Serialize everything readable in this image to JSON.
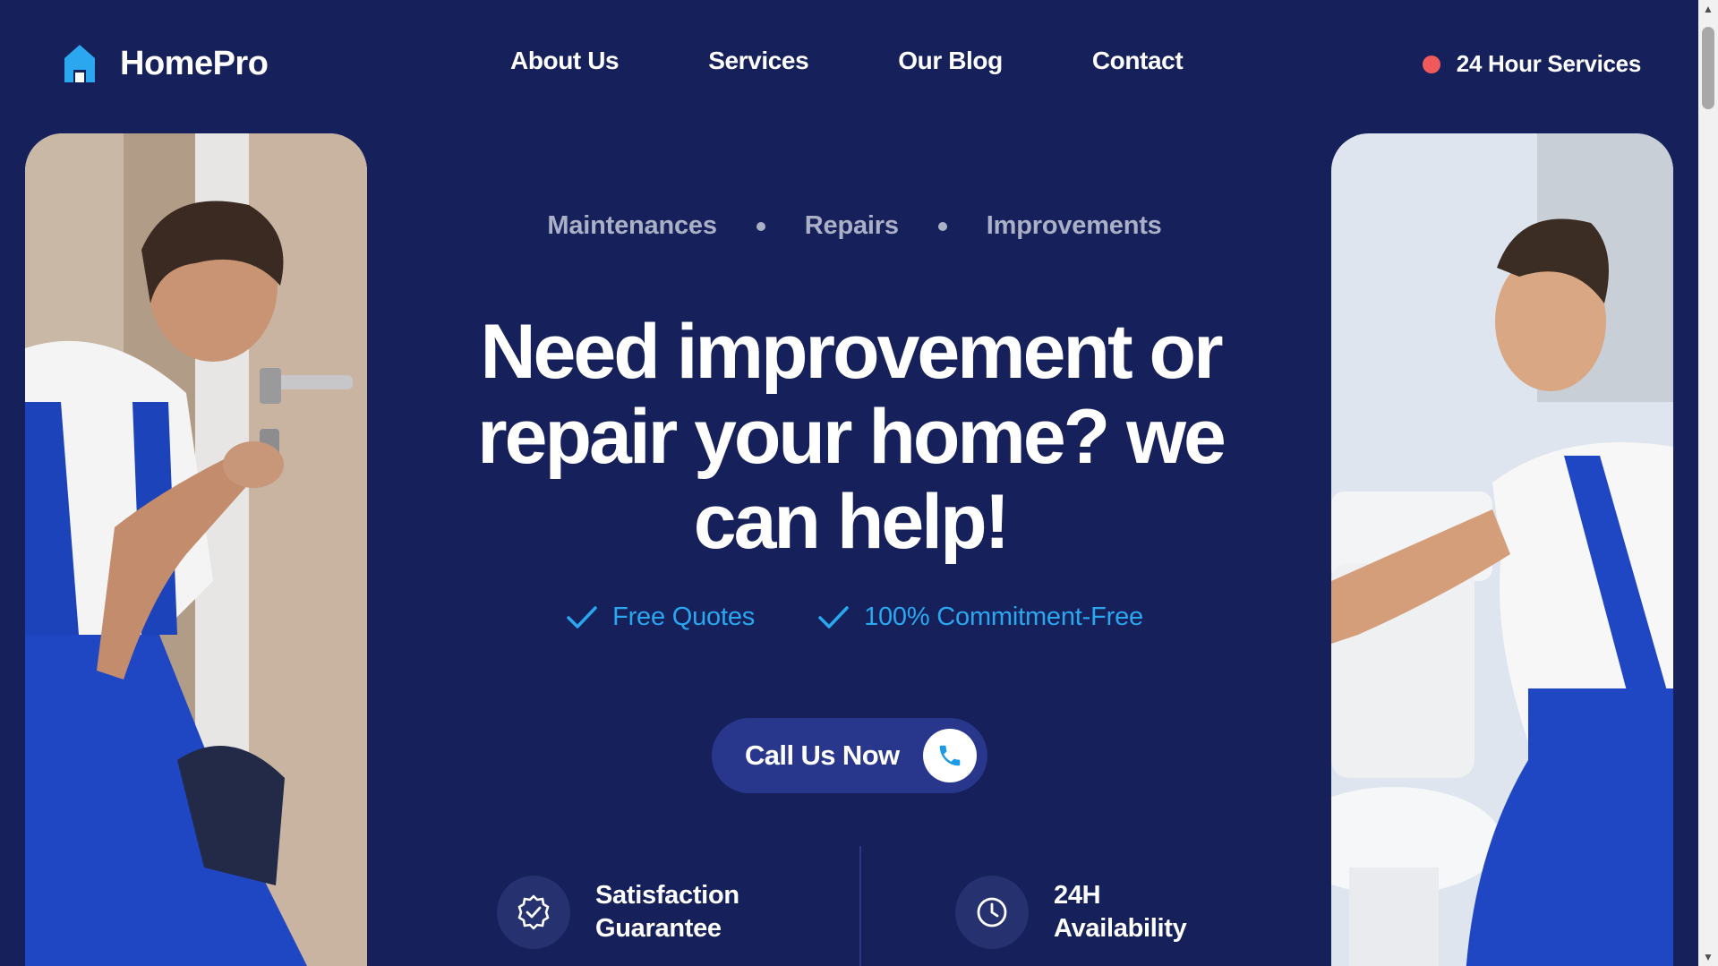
{
  "header": {
    "brand": "HomePro",
    "nav": [
      "About Us",
      "Services",
      "Our Blog",
      "Contact"
    ],
    "hours_label": "24 Hour Services"
  },
  "hero": {
    "tags": [
      "Maintenances",
      "Repairs",
      "Improvements"
    ],
    "headline_lines": [
      "Need improvement or",
      "repair your home? we",
      "can help!"
    ],
    "checks": [
      "Free Quotes",
      "100% Commitment-Free"
    ],
    "cta_label": "Call Us Now"
  },
  "features": [
    {
      "line1": "Satisfaction",
      "line2": "Guarantee",
      "icon": "badge-check-icon"
    },
    {
      "line1": "24H",
      "line2": "Availability",
      "icon": "clock-icon"
    }
  ],
  "colors": {
    "background": "#16205a",
    "accent": "#2aa7ee",
    "button": "#28378c",
    "status_dot": "#f05a5a",
    "muted_text": "#aab0c6"
  },
  "images": {
    "left": "worker-fixing-door-lock",
    "right": "worker-fixing-toilet"
  }
}
